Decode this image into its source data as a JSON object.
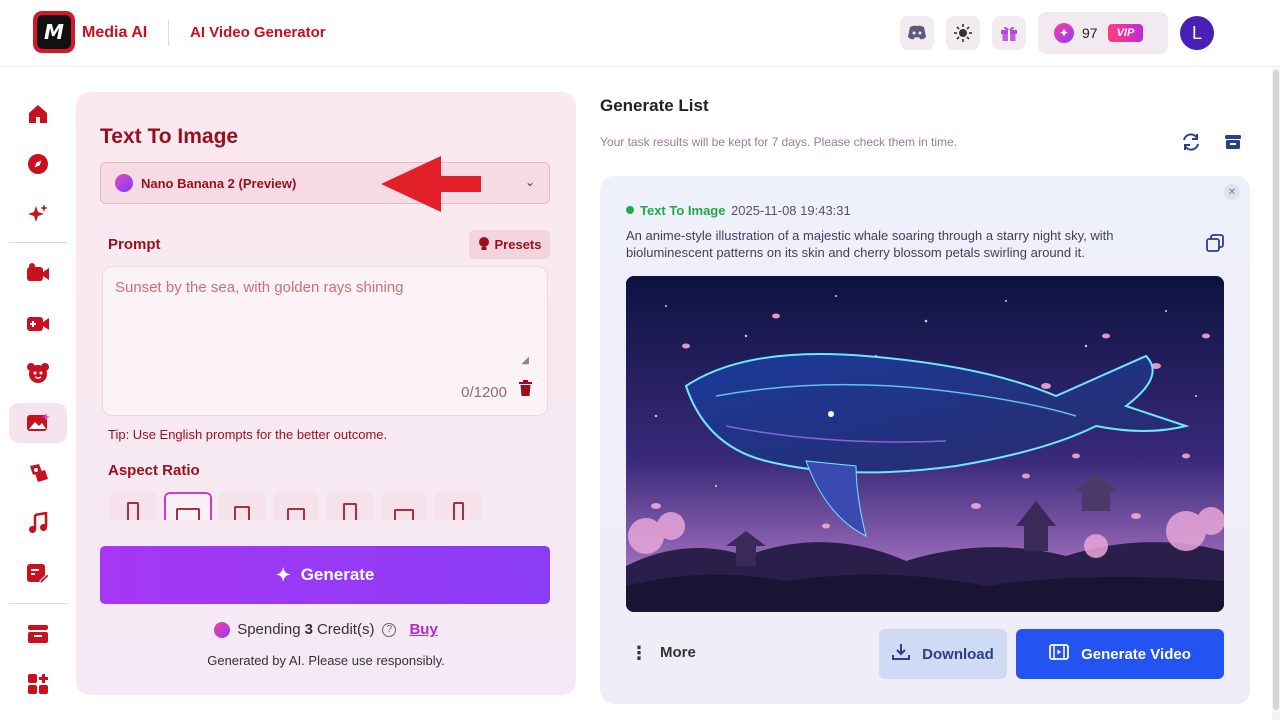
{
  "header": {
    "logo_text": "M",
    "brand": "Media AI",
    "app_title": "AI Video Generator",
    "credits": "97",
    "vip": "VIP",
    "avatar_initial": "L",
    "icons": [
      "discord-icon",
      "sun-icon",
      "gift-icon"
    ]
  },
  "sidebar": {
    "items": [
      "home-icon",
      "compass-icon",
      "sparkle-icon",
      "video-camera-icon",
      "video-plus-icon",
      "mascot-icon",
      "image-ai-icon",
      "effects-icon",
      "music-note-icon",
      "image-edit-icon",
      "storage-icon",
      "apps-icon"
    ],
    "active_index": 6
  },
  "left_panel": {
    "title": "Text To Image",
    "model": "Nano Banana 2 (Preview)",
    "prompt_label": "Prompt",
    "presets_label": "Presets",
    "prompt_placeholder": "Sunset by the sea, with golden rays shining",
    "counter": "0/1200",
    "tip": "Tip: Use English prompts for the better outcome.",
    "aspect_label": "Aspect Ratio",
    "selected_ratio_index": 1,
    "generate_label": "Generate",
    "spending_prefix": "Spending",
    "spending_amount": "3",
    "spending_suffix": "Credit(s)",
    "buy_label": "Buy",
    "disclaimer": "Generated by AI. Please use responsibly."
  },
  "generate_list": {
    "title": "Generate List",
    "subtitle": "Your task results will be kept for 7 days. Please check them in time.",
    "card": {
      "status": "Text To Image",
      "timestamp": "2025-11-08 19:43:31",
      "prompt": "An anime-style illustration of a majestic whale soaring through a starry night sky, with bioluminescent patterns on its skin and cherry blossom petals swirling around it.",
      "more_label": "More",
      "download_label": "Download",
      "generate_video_label": "Generate Video"
    }
  },
  "colors": {
    "brand_red": "#c8101e",
    "panel_text": "#9a0f1e",
    "generate_purple": "#a637f5",
    "primary_blue": "#2353f0",
    "status_green": "#22a84a"
  }
}
